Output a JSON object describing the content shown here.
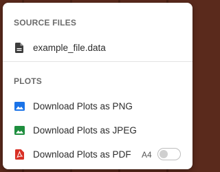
{
  "menu": {
    "source_files": {
      "header": "SOURCE FILES",
      "file_name": "example_file.data",
      "file_icon": "document-icon"
    },
    "plots": {
      "header": "PLOTS",
      "items": [
        {
          "label": "Download Plots as PNG",
          "icon": "image-icon",
          "icon_color": "#1a73e8"
        },
        {
          "label": "Download Plots as JPEG",
          "icon": "image-icon",
          "icon_color": "#1e8e3e"
        },
        {
          "label": "Download Plots as PDF",
          "icon": "pdf-icon",
          "icon_color": "#d93025"
        }
      ],
      "pdf_paper_label": "A4",
      "pdf_a4_toggle_on": false
    }
  },
  "colors": {
    "background": "#5a2a1c",
    "menu_bg": "#ffffff",
    "header_text": "#6b6b6b"
  }
}
